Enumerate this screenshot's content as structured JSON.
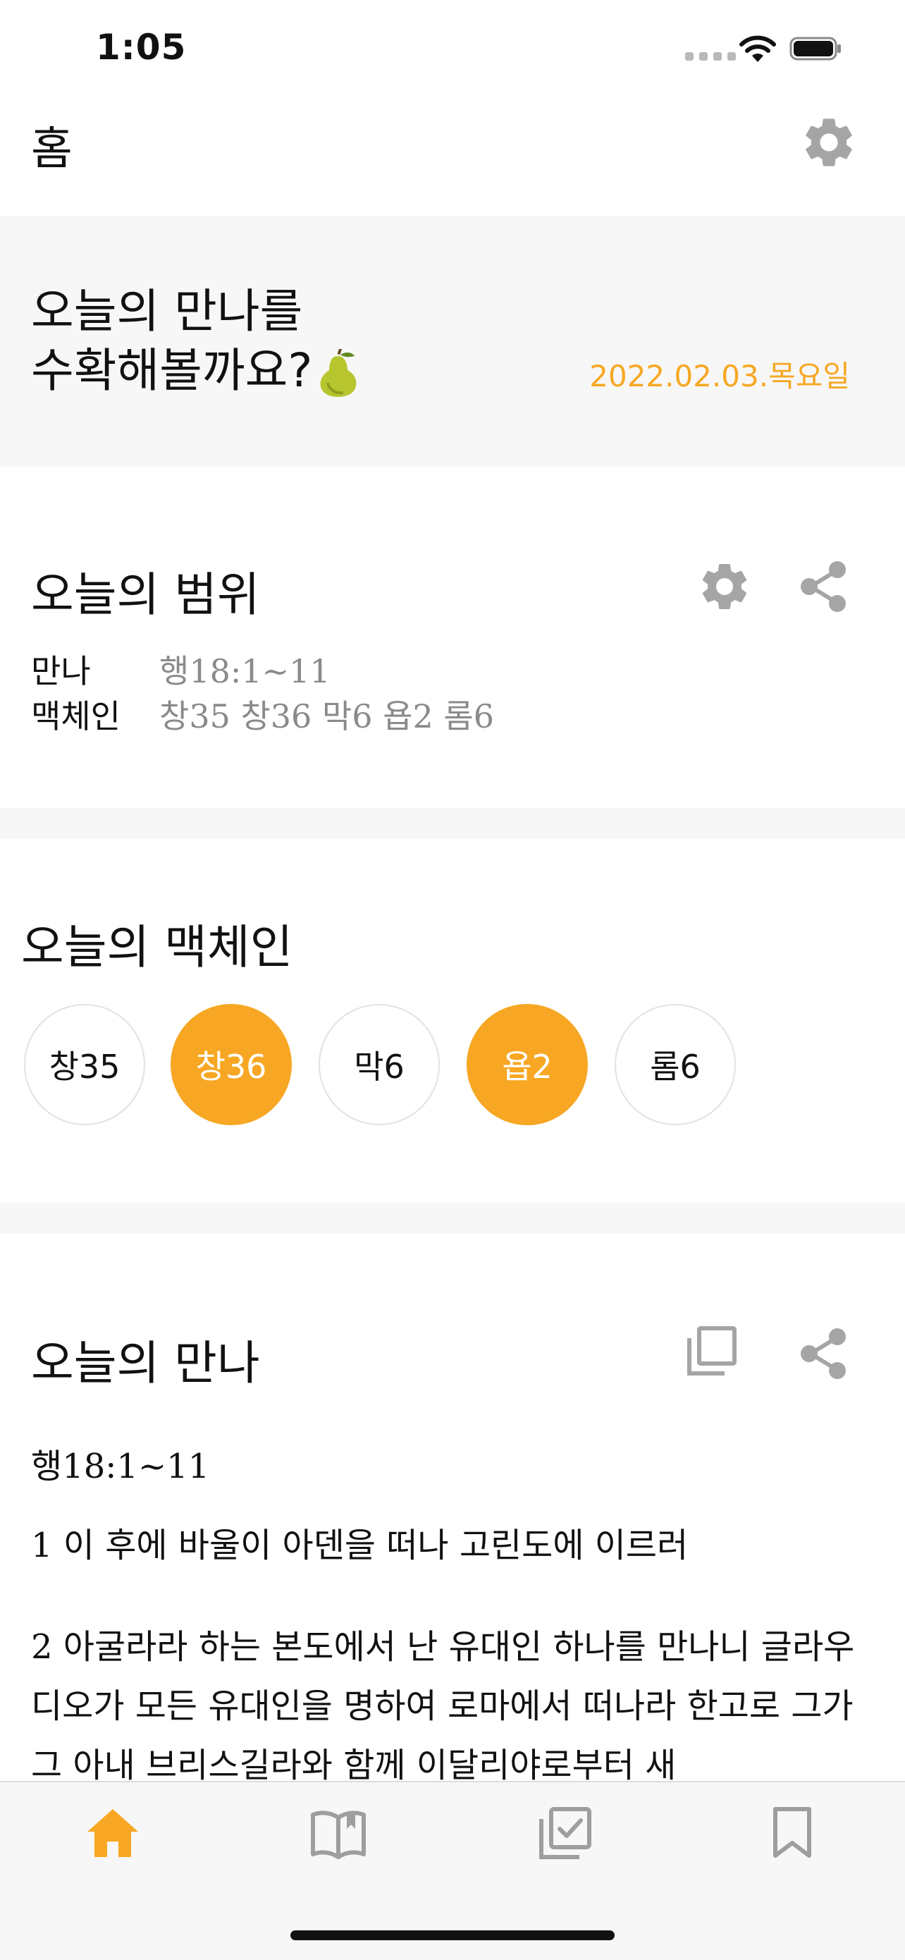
{
  "status_bar": {
    "time": "1:05"
  },
  "header": {
    "title": "홈"
  },
  "greeting": {
    "line1": "오늘의 만나를",
    "line2": "수확해볼까요?",
    "date": "2022.02.03.목요일"
  },
  "range": {
    "title": "오늘의 범위",
    "rows": [
      {
        "label": "만나",
        "value": "행18:1~11"
      },
      {
        "label": "맥체인",
        "value": "창35 창36 막6 욥2 롬6"
      }
    ]
  },
  "mccheyne": {
    "title": "오늘의 맥체인",
    "chips": [
      {
        "label": "창35",
        "active": false
      },
      {
        "label": "창36",
        "active": true
      },
      {
        "label": "막6",
        "active": false
      },
      {
        "label": "욥2",
        "active": true
      },
      {
        "label": "롬6",
        "active": false
      }
    ]
  },
  "manna": {
    "title": "오늘의 만나",
    "reference": "행18:1~11",
    "verses": [
      "1 이 후에 바울이 아덴을 떠나 고린도에 이르러",
      "2 아굴라라 하는 본도에서 난 유대인 하나를 만나니 글라우디오가 모든 유대인을 명하여 로마에서 떠나라 한고로 그가 그 아내 브리스길라와 함께 이달리야로부터 새"
    ]
  },
  "tabbar": {
    "tabs": [
      {
        "icon": "home-icon",
        "active": true
      },
      {
        "icon": "open-book-icon",
        "active": false
      },
      {
        "icon": "checklist-icon",
        "active": false
      },
      {
        "icon": "bookmark-icon",
        "active": false
      }
    ]
  },
  "colors": {
    "accent": "#f7a723",
    "icon_grey": "#9e9e9e",
    "section_bg": "#f7f7f7"
  }
}
